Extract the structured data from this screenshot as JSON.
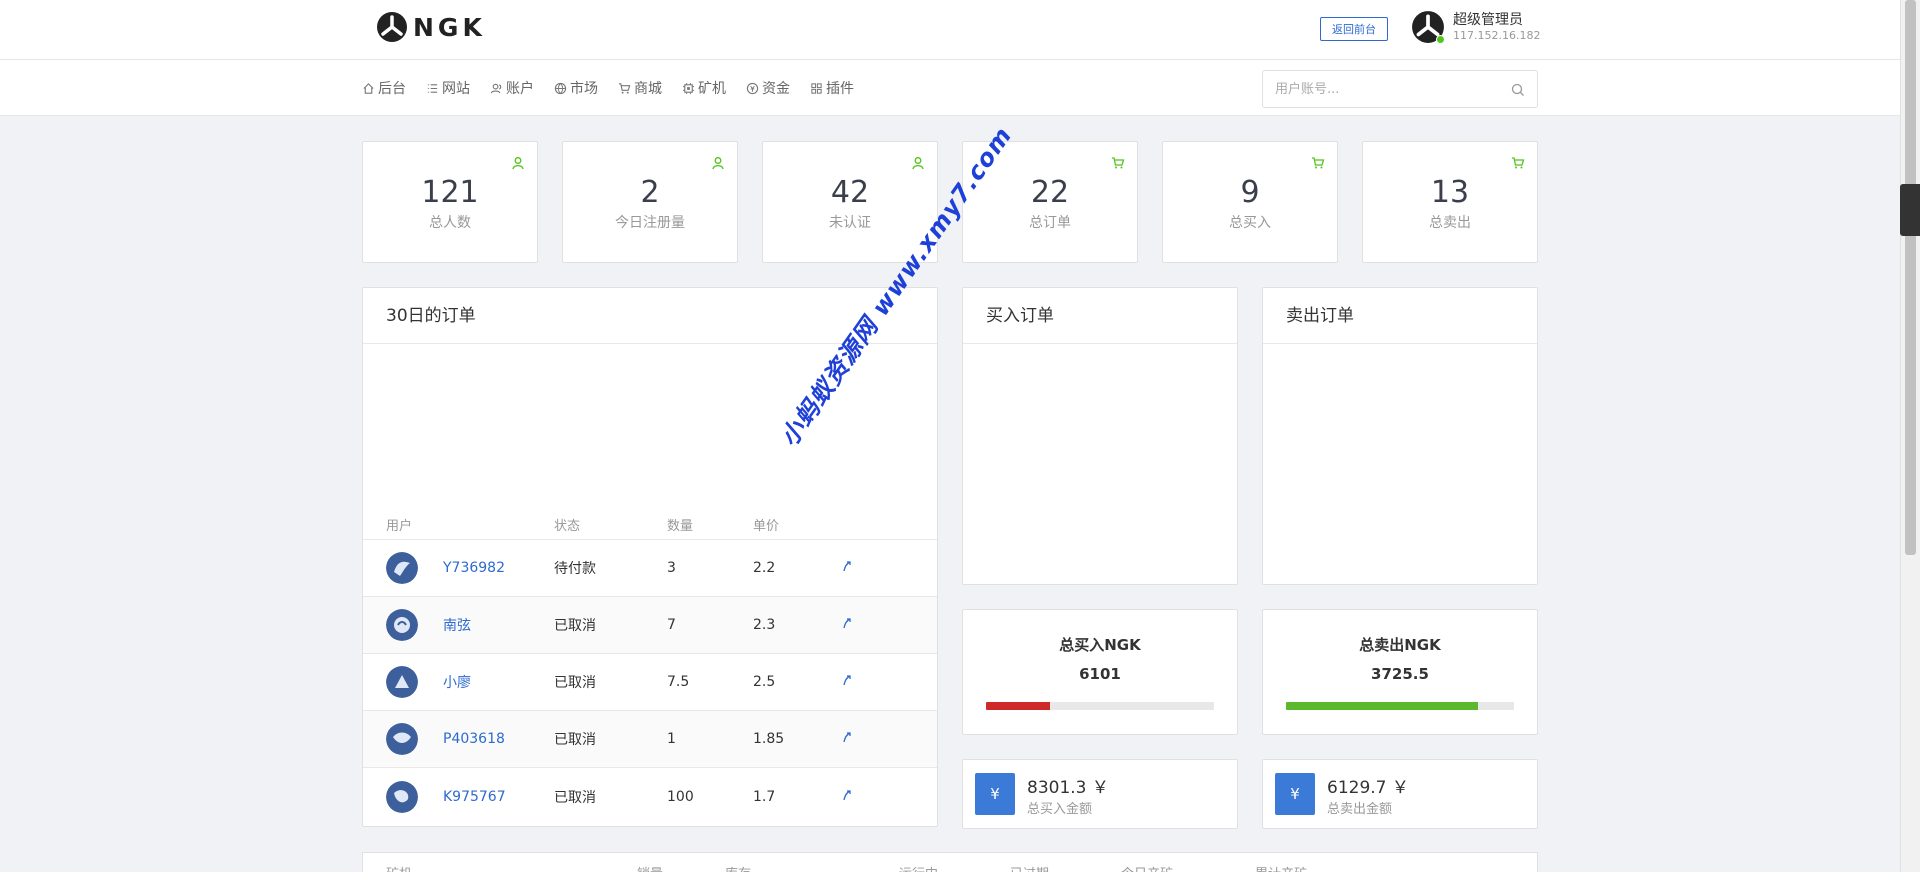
{
  "header": {
    "logo_text": "NGK",
    "back_button": "返回前台",
    "user_name": "超级管理员",
    "user_ip": "117.152.16.182"
  },
  "nav": {
    "items": [
      {
        "label": "后台",
        "icon": "home-icon"
      },
      {
        "label": "网站",
        "icon": "list-icon"
      },
      {
        "label": "账户",
        "icon": "users-icon"
      },
      {
        "label": "市场",
        "icon": "globe-icon"
      },
      {
        "label": "商城",
        "icon": "cart-icon"
      },
      {
        "label": "矿机",
        "icon": "chip-icon"
      },
      {
        "label": "资金",
        "icon": "fund-icon"
      },
      {
        "label": "插件",
        "icon": "grid-icon"
      }
    ],
    "search_placeholder": "用户账号..."
  },
  "stats": [
    {
      "value": "121",
      "label": "总人数",
      "icon": "user-icon"
    },
    {
      "value": "2",
      "label": "今日注册量",
      "icon": "user-icon"
    },
    {
      "value": "42",
      "label": "未认证",
      "icon": "user-icon"
    },
    {
      "value": "22",
      "label": "总订单",
      "icon": "cart-icon"
    },
    {
      "value": "9",
      "label": "总买入",
      "icon": "cart-icon"
    },
    {
      "value": "13",
      "label": "总卖出",
      "icon": "cart-icon"
    }
  ],
  "orders_panel": {
    "title": "30日的订单",
    "columns": [
      "用户",
      "状态",
      "数量",
      "单价"
    ],
    "rows": [
      {
        "user": "Y736982",
        "status": "待付款",
        "qty": "3",
        "price": "2.2"
      },
      {
        "user": "南弦",
        "status": "已取消",
        "qty": "7",
        "price": "2.3"
      },
      {
        "user": "小廖",
        "status": "已取消",
        "qty": "7.5",
        "price": "2.5"
      },
      {
        "user": "P403618",
        "status": "已取消",
        "qty": "1",
        "price": "1.85"
      },
      {
        "user": "K975767",
        "status": "已取消",
        "qty": "100",
        "price": "1.7"
      }
    ]
  },
  "buy_panel": {
    "title": "买入订单"
  },
  "sell_panel": {
    "title": "卖出订单"
  },
  "totals": {
    "buy_title": "总买入NGK",
    "buy_value": "6101",
    "buy_ratio": 0.28,
    "buy_color": "#cf2a2a",
    "sell_title": "总卖出NGK",
    "sell_value": "3725.5",
    "sell_ratio": 0.84,
    "sell_color": "#5cb82d"
  },
  "money": {
    "currency_symbol": "¥",
    "buy_amount": "8301.3 ￥",
    "buy_label": "总买入金额",
    "sell_amount": "6129.7 ￥",
    "sell_label": "总卖出金额"
  },
  "machines_table": {
    "columns": [
      "矿机",
      "销量",
      "库存",
      "运行中",
      "已过期",
      "今日产矿",
      "累计产矿"
    ]
  },
  "watermark": "小蚂蚁资源网  www.xmy7.com",
  "colors": {
    "accent": "#2d6ad0",
    "stat_icon": "#52c41a",
    "money_icon_bg": "#3b7bd7"
  }
}
